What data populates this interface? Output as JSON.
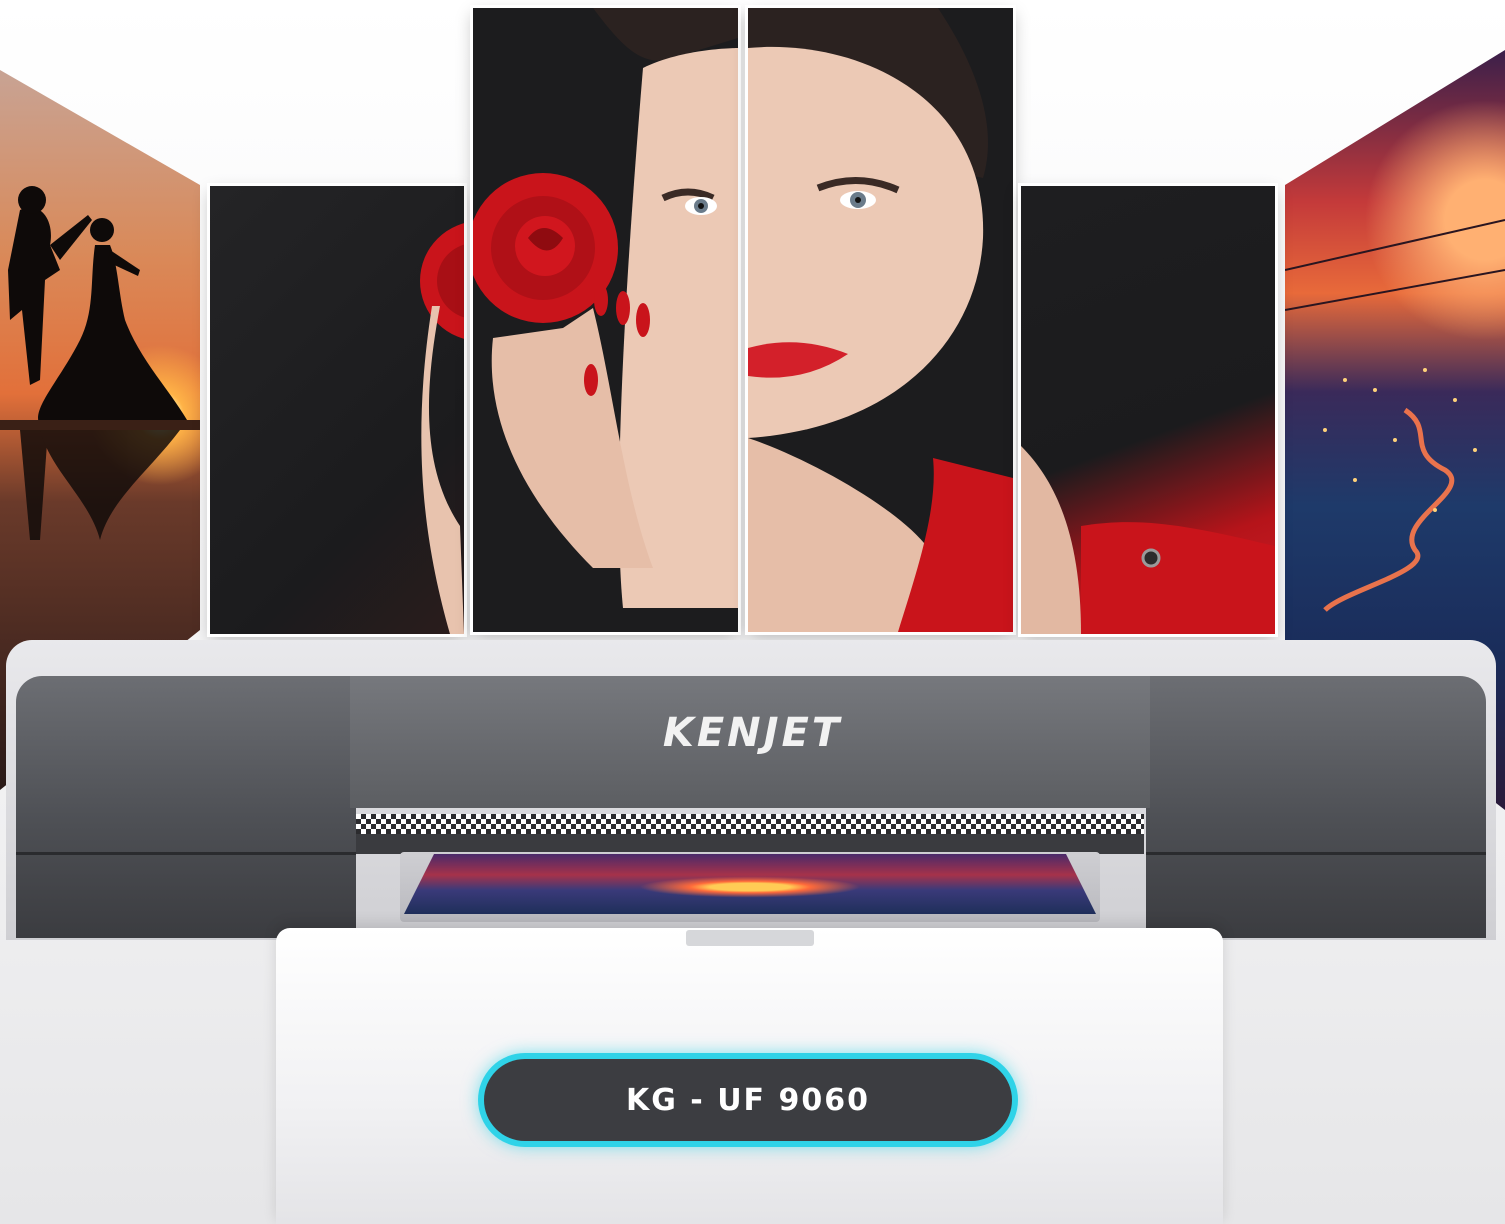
{
  "brand": {
    "logo_text": "KENJET"
  },
  "product": {
    "model_label": "KG - UF 9060"
  },
  "colors": {
    "badge_glow": "#2fd3e8",
    "badge_fill": "#3c3d41",
    "printer_gray": "#5c5e62",
    "rose_red": "#c9141b"
  },
  "scene": {
    "icons": [
      "rose-icon",
      "dancing-couple-silhouette",
      "sunset-sun",
      "checker-strip"
    ]
  }
}
